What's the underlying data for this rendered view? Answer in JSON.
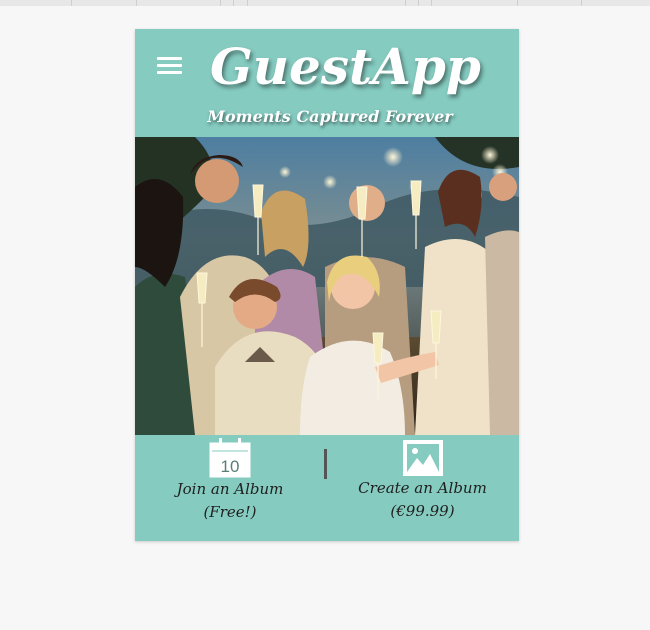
{
  "app": {
    "title": "GuestApp",
    "subtitle": "Moments Captured Forever"
  },
  "icons": {
    "menu": "hamburger-menu-icon",
    "calendar": "calendar-icon",
    "image": "image-icon"
  },
  "calendar_day": "10",
  "actions": {
    "join_label": "Join an Album",
    "join_note": "(Free!)",
    "create_label": "Create an Album",
    "create_note": "(€99.99)"
  },
  "colors": {
    "accent": "#85cbc0",
    "background": "#f7f7f7"
  }
}
